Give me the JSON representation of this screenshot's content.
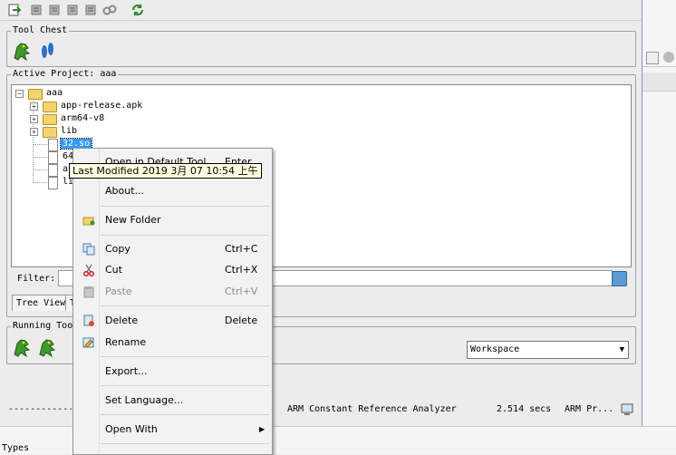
{
  "tool_chest": {
    "title": "Tool Chest"
  },
  "project": {
    "title": "Active Project: aaa",
    "root": "aaa",
    "items": [
      {
        "label": "app-release.apk",
        "kind": "folder"
      },
      {
        "label": "arm64-v8",
        "kind": "folder"
      },
      {
        "label": "lib",
        "kind": "folder"
      },
      {
        "label": "32.so",
        "kind": "file",
        "selected": true
      },
      {
        "label": "64",
        "kind": "file"
      },
      {
        "label": "a",
        "kind": "file"
      },
      {
        "label": "li",
        "kind": "file"
      }
    ]
  },
  "filter": {
    "label": "Filter:",
    "value": ""
  },
  "tabs": {
    "tree_view": "Tree View",
    "second_partial": "T"
  },
  "running_tools": {
    "title": "Running Tools"
  },
  "workspace": {
    "selected": "Workspace"
  },
  "status": {
    "separator": "------------",
    "tool": "ARM Constant Reference Analyzer",
    "time": "2.514 secs",
    "arch": "ARM Pr..."
  },
  "tooltip": {
    "text": "Last Modified 2019 3月 07 10:54 上午"
  },
  "context_menu": {
    "open_default": {
      "label": "Open in Default Tool",
      "shortcut": "Enter"
    },
    "about": {
      "label": "About..."
    },
    "new_folder": {
      "label": "New Folder"
    },
    "copy": {
      "label": "Copy",
      "shortcut": "Ctrl+C"
    },
    "cut": {
      "label": "Cut",
      "shortcut": "Ctrl+X"
    },
    "paste": {
      "label": "Paste",
      "shortcut": "Ctrl+V"
    },
    "delete": {
      "label": "Delete",
      "shortcut": "Delete"
    },
    "rename": {
      "label": "Rename"
    },
    "export": {
      "label": "Export..."
    },
    "set_language": {
      "label": "Set Language..."
    },
    "open_with": {
      "label": "Open With",
      "submenu_arrow": "▶"
    }
  },
  "bottom_strip": {
    "types_label": "Types"
  },
  "colors": {
    "selection": "#3399ff",
    "tooltip_bg": "#ffffe1",
    "dragon_green": "#3e9a2a"
  }
}
